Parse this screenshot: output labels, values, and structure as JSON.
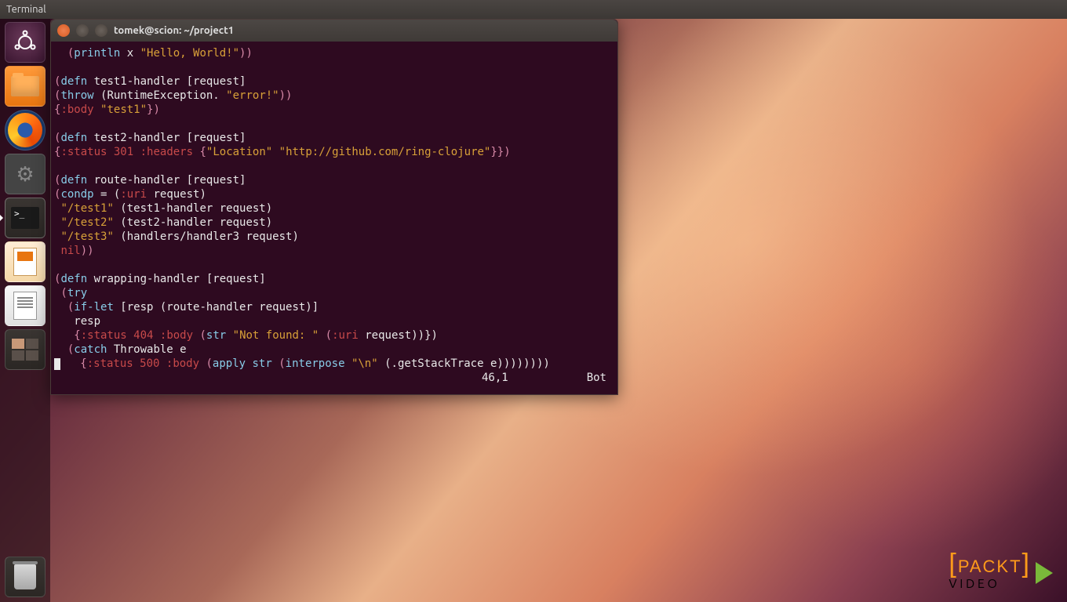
{
  "menubar": {
    "title": "Terminal"
  },
  "window": {
    "title": "tomek@scion: ~/project1"
  },
  "launcher": {
    "items": [
      {
        "name": "dash",
        "label": "Dash"
      },
      {
        "name": "files",
        "label": "Files"
      },
      {
        "name": "firefox",
        "label": "Firefox"
      },
      {
        "name": "settings",
        "label": "System Settings"
      },
      {
        "name": "terminal",
        "label": "Terminal",
        "active": true
      },
      {
        "name": "impress",
        "label": "LibreOffice Impress"
      },
      {
        "name": "writer",
        "label": "LibreOffice Writer"
      },
      {
        "name": "workspace",
        "label": "Workspace Switcher"
      }
    ],
    "trash": {
      "label": "Trash"
    }
  },
  "code": {
    "l1": {
      "pre": "  (",
      "fn": "println",
      "mid": " x ",
      "str": "\"Hello, World!\"",
      "post": "))"
    },
    "l3": {
      "open": "(",
      "kw": "defn",
      "name": " test1-handler ",
      "args": "[request]"
    },
    "l4": {
      "pre": "(",
      "fn": "throw",
      "mid": " (RuntimeException. ",
      "str": "\"error!\"",
      "post": "))"
    },
    "l5": {
      "pre": "{",
      "k": ":body",
      "sp": " ",
      "str": "\"test1\"",
      "post": "})"
    },
    "l7": {
      "open": "(",
      "kw": "defn",
      "name": " test2-handler ",
      "args": "[request]"
    },
    "l8": {
      "pre": "{",
      "k1": ":status",
      "n": " 301 ",
      "k2": ":headers",
      "mid": " {",
      "s1": "\"Location\"",
      "sp": " ",
      "s2": "\"http://github.com/ring-clojure\"",
      "post": "}})"
    },
    "l10": {
      "open": "(",
      "kw": "defn",
      "name": " route-handler ",
      "args": "[request]"
    },
    "l11": {
      "pre": "(",
      "fn": "condp",
      "mid": " = (",
      "k": ":uri",
      "post": " request)"
    },
    "l12": {
      "str": "\"/test1\"",
      "rest": " (test1-handler request)"
    },
    "l13": {
      "str": "\"/test2\"",
      "rest": " (test2-handler request)"
    },
    "l14": {
      "str": "\"/test3\"",
      "rest": " (handlers/handler3 request)"
    },
    "l15": {
      "nil": "nil",
      "post": "))"
    },
    "l17": {
      "open": "(",
      "kw": "defn",
      "name": " wrapping-handler ",
      "args": "[request]"
    },
    "l18": {
      "pre": " (",
      "kw": "try"
    },
    "l19": {
      "pre": "  (",
      "kw": "if-let",
      "mid": " [resp (route-handler request)]"
    },
    "l20": "   resp",
    "l21": {
      "pre": "   {",
      "k1": ":status",
      "n": " 404 ",
      "k2": ":body",
      "mid": " (",
      "fn": "str",
      "sp": " ",
      "str": "\"Not found: \"",
      "mid2": " (",
      "k3": ":uri",
      "post": " request))})"
    },
    "l22": {
      "pre": "  (",
      "kw": "catch",
      "rest": " Throwable e"
    },
    "l23": {
      "pre": "   {",
      "k1": ":status",
      "n": " 500 ",
      "k2": ":body",
      "mid": " (",
      "fn1": "apply",
      "sp": " ",
      "fn2": "str",
      "mid2": " (",
      "fn3": "interpose",
      "sp2": " ",
      "str": "\"\\n\"",
      "post": " (.getStackTrace e))))))))"
    }
  },
  "status": {
    "position": "46,1",
    "scroll": "Bot"
  },
  "watermark": {
    "brand": "PACKT",
    "sub": "V I D E O"
  }
}
